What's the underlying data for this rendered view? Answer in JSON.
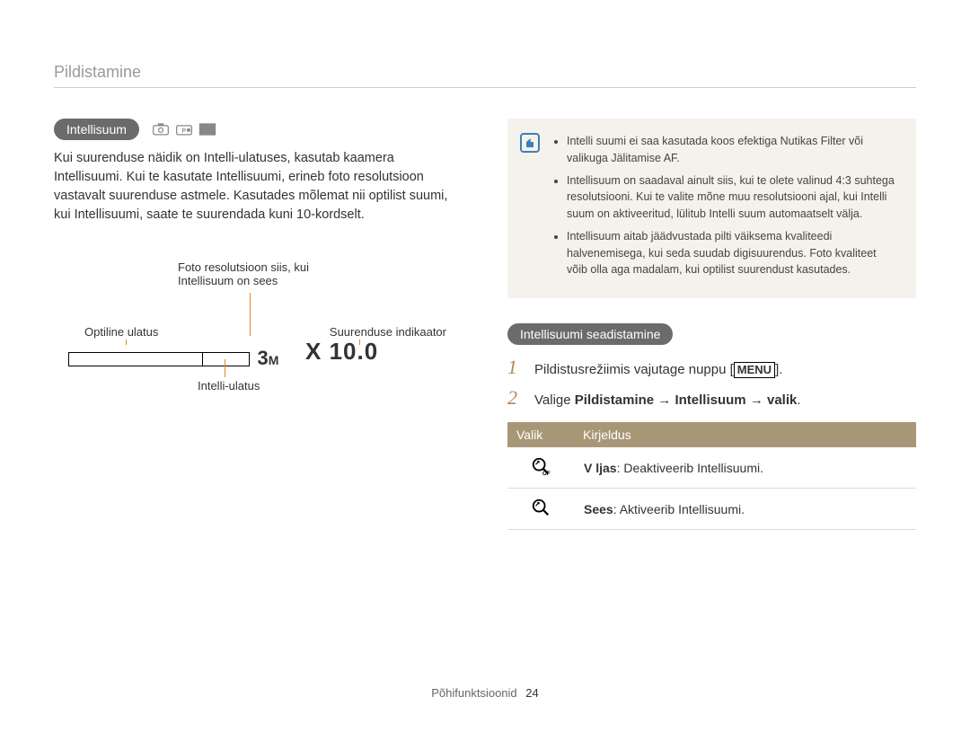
{
  "header": {
    "title": "Pildistamine"
  },
  "left": {
    "badge": "Intellisuum",
    "paragraph": "Kui suurenduse näidik on Intelli-ulatuses, kasutab kaamera Intellisuumi. Kui te kasutate Intellisuumi, erineb foto resolutsioon vastavalt suurenduse astmele. Kasutades mõlemat nii optilist suumi, kui Intellisuumi, saate te suurendada kuni 10-kordselt.",
    "diagram": {
      "label_top": "Foto resolutsioon siis, kui Intellisuum on sees",
      "label_left": "Optiline ulatus",
      "label_right": "Suurenduse indikaator",
      "label_bottom": "Intelli-ulatus",
      "res_value": "3",
      "res_suffix": "M",
      "zoom_value": "X 10.0"
    }
  },
  "right": {
    "info_bullets": [
      "Intelli suumi ei saa kasutada koos efektiga Nutikas Filter või valikuga Jälitamise AF.",
      "Intellisuum on saadaval ainult siis, kui te olete valinud 4:3 suhtega resolutsiooni. Kui te valite mõne muu resolutsiooni ajal, kui Intelli suum on aktiveeritud, lülitub Intelli suum automaatselt välja.",
      "Intellisuum aitab jäädvustada pilti väiksema kvaliteedi halvenemisega, kui seda suudab digisuurendus. Foto kvaliteet võib olla aga madalam, kui optilist suurendust kasutades."
    ],
    "sub_badge": "Intellisuumi seadistamine",
    "steps": {
      "one_prefix": "Pildistusrežiimis vajutage nuppu [",
      "one_menu": "MENU",
      "one_suffix": "].",
      "two_prefix": "Valige ",
      "two_bold1": "Pildistamine",
      "two_arrow1": " → ",
      "two_bold2": "Intellisuum",
      "two_arrow2": " → ",
      "two_bold3": "valik",
      "two_suffix": "."
    },
    "table": {
      "header_valik": "Valik",
      "header_kirjeldus": "Kirjeldus",
      "row1_prefix": "V ljas",
      "row1_desc": ": Deaktiveerib Intellisuumi.",
      "row2_prefix": "Sees",
      "row2_desc": ": Aktiveerib Intellisuumi."
    }
  },
  "footer": {
    "text": "Põhifunktsioonid",
    "page": "24"
  }
}
